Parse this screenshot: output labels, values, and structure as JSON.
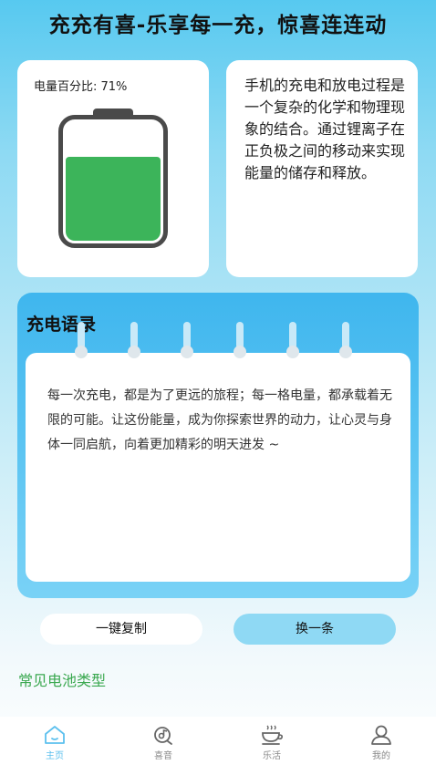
{
  "header": {
    "title": "充充有喜-乐享每一充，惊喜连连动"
  },
  "battery": {
    "label": "电量百分比: 71%",
    "percent": 0.71,
    "fill_color": "#3cb45a"
  },
  "info": {
    "text": "手机的充电和放电过程是一个复杂的化学和物理现象的结合。通过锂离子在正负极之间的移动来实现能量的储存和释放。"
  },
  "quote": {
    "title": "充电语录",
    "text": "每一次充电，都是为了更远的旅程；每一格电量，都承载着无限的可能。让这份能量，成为你探索世界的动力，让心灵与身体一同启航，向着更加精彩的明天进发 ~"
  },
  "actions": {
    "copy_label": "一键复制",
    "next_label": "换一条"
  },
  "section": {
    "title": "常见电池类型"
  },
  "tabs": [
    {
      "label": "主页",
      "icon": "home-icon",
      "active": true
    },
    {
      "label": "喜音",
      "icon": "music-icon",
      "active": false
    },
    {
      "label": "乐活",
      "icon": "coffee-icon",
      "active": false
    },
    {
      "label": "我的",
      "icon": "user-icon",
      "active": false
    }
  ],
  "colors": {
    "accent": "#5cc0ee",
    "section_green": "#3aa84f"
  }
}
